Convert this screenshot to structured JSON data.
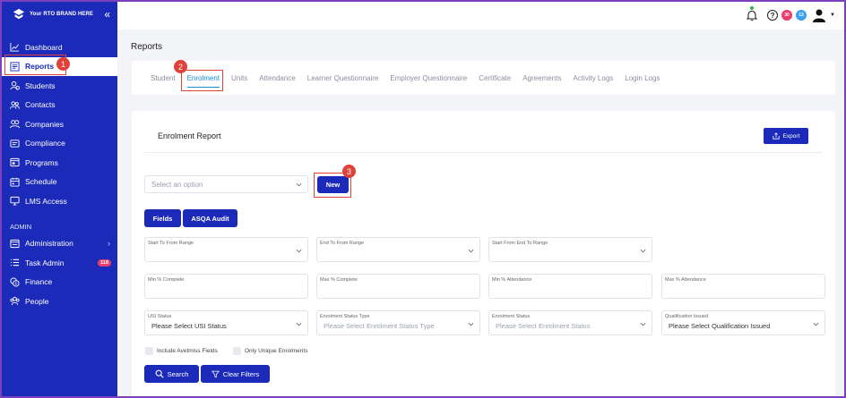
{
  "brand": {
    "name": "Your RTO BRAND HERE"
  },
  "sidebar": {
    "items": [
      {
        "label": "Dashboard",
        "icon": "chart-line-icon"
      },
      {
        "label": "Reports",
        "icon": "report-icon",
        "active": true
      },
      {
        "label": "Students",
        "icon": "students-icon"
      },
      {
        "label": "Contacts",
        "icon": "contacts-icon"
      },
      {
        "label": "Companies",
        "icon": "companies-icon"
      },
      {
        "label": "Compliance",
        "icon": "compliance-icon"
      },
      {
        "label": "Programs",
        "icon": "programs-icon"
      },
      {
        "label": "Schedule",
        "icon": "schedule-icon"
      },
      {
        "label": "LMS Access",
        "icon": "lms-icon"
      }
    ],
    "admin_label": "ADMIN",
    "admin_items": [
      {
        "label": "Administration",
        "icon": "administration-icon"
      },
      {
        "label": "Task Admin",
        "icon": "task-list-icon",
        "badge": "118"
      },
      {
        "label": "Finance",
        "icon": "finance-icon"
      },
      {
        "label": "People",
        "icon": "people-icon"
      }
    ]
  },
  "topbar": {
    "badge_red": "30",
    "badge_blue": "13",
    "help": "?"
  },
  "page": {
    "title": "Reports"
  },
  "tabs": [
    "Student",
    "Enrolment",
    "Units",
    "Attendance",
    "Learner Questionnaire",
    "Employer Questionnaire",
    "Certificate",
    "Agreements",
    "Activity Logs",
    "Login Logs"
  ],
  "report": {
    "title": "Enrolment Report",
    "export_label": "Export",
    "select_placeholder": "Select an option",
    "new_label": "New",
    "fields_label": "Fields",
    "asqa_label": "ASQA Audit",
    "filters_row1": [
      "Start To From Range",
      "End To From Range",
      "Start From End To Range"
    ],
    "filters_row2": [
      "Min % Complete",
      "Max % Complete",
      "Min % Attendance",
      "Max % Attendance"
    ],
    "filters_row3": [
      {
        "label": "USI Status",
        "value": "Please Select USI Status"
      },
      {
        "label": "Enrolment Status Type",
        "value": "Please Select Enrolment Status Type"
      },
      {
        "label": "Enrolment Status",
        "value": "Please Select Enrolment Status"
      },
      {
        "label": "Qualification Issued",
        "value": "Please Select Qualification Issued"
      }
    ],
    "check_avetmiss": "Include Avetmiss Fields",
    "check_unique": "Only Unique Enrolments",
    "search_label": "Search",
    "clear_label": "Clear Filters"
  },
  "annotations": [
    "1",
    "2",
    "3"
  ],
  "colors": {
    "primary": "#1b2ab8",
    "accent": "#1b8bd6",
    "annotation": "#e0413a"
  }
}
